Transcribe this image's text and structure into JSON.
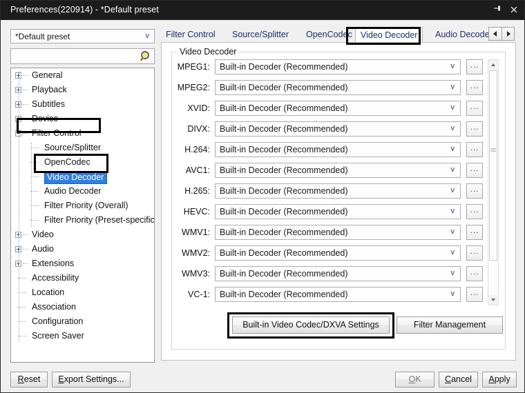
{
  "window": {
    "title": "Preferences(220914) - *Default preset",
    "pin_icon": "pin-icon",
    "close_icon": "close-icon"
  },
  "sidebar": {
    "preset": {
      "value": "*Default preset",
      "chevron": "v"
    },
    "search": {
      "value": "",
      "placeholder": "",
      "icon": "search-icon"
    },
    "tree": [
      {
        "label": "General",
        "level": 0,
        "expander": "plus"
      },
      {
        "label": "Playback",
        "level": 0,
        "expander": "plus"
      },
      {
        "label": "Subtitles",
        "level": 0,
        "expander": "plus"
      },
      {
        "label": "Device",
        "level": 0,
        "expander": "plus"
      },
      {
        "label": "Filter Control",
        "level": 0,
        "expander": "minus"
      },
      {
        "label": "Source/Splitter",
        "level": 1,
        "expander": "leaf"
      },
      {
        "label": "OpenCodec",
        "level": 1,
        "expander": "leaf"
      },
      {
        "label": "Video Decoder",
        "level": 1,
        "expander": "leaf",
        "selected": true
      },
      {
        "label": "Audio Decoder",
        "level": 1,
        "expander": "leaf"
      },
      {
        "label": "Filter Priority (Overall)",
        "level": 1,
        "expander": "leaf"
      },
      {
        "label": "Filter Priority (Preset-specific)",
        "level": 1,
        "expander": "leaf"
      },
      {
        "label": "Video",
        "level": 0,
        "expander": "plus"
      },
      {
        "label": "Audio",
        "level": 0,
        "expander": "plus"
      },
      {
        "label": "Extensions",
        "level": 0,
        "expander": "plus"
      },
      {
        "label": "Accessibility",
        "level": 0,
        "expander": "leaf"
      },
      {
        "label": "Location",
        "level": 0,
        "expander": "leaf"
      },
      {
        "label": "Association",
        "level": 0,
        "expander": "leaf"
      },
      {
        "label": "Configuration",
        "level": 0,
        "expander": "leaf"
      },
      {
        "label": "Screen Saver",
        "level": 0,
        "expander": "leaf"
      }
    ]
  },
  "tabs": {
    "items": [
      {
        "label": "Filter Control",
        "active": false
      },
      {
        "label": "Source/Splitter",
        "active": false
      },
      {
        "label": "OpenCodec",
        "active": false
      },
      {
        "label": "Video Decoder",
        "active": true
      },
      {
        "label": "Audio Decoder",
        "active": false
      }
    ],
    "scroll_left_icon": "triangle-left-icon",
    "scroll_right_icon": "triangle-right-icon"
  },
  "main": {
    "groupbox_title": "Video Decoder",
    "decoder_value": "Built-in Decoder (Recommended)",
    "combo_chevron": "v",
    "dots_label": "...",
    "rows": [
      {
        "codec": "MPEG1:",
        "value": "Built-in Decoder (Recommended)"
      },
      {
        "codec": "MPEG2:",
        "value": "Built-in Decoder (Recommended)"
      },
      {
        "codec": "XVID:",
        "value": "Built-in Decoder (Recommended)"
      },
      {
        "codec": "DIVX:",
        "value": "Built-in Decoder (Recommended)"
      },
      {
        "codec": "H.264:",
        "value": "Built-in Decoder (Recommended)"
      },
      {
        "codec": "AVC1:",
        "value": "Built-in Decoder (Recommended)"
      },
      {
        "codec": "H.265:",
        "value": "Built-in Decoder (Recommended)"
      },
      {
        "codec": "HEVC:",
        "value": "Built-in Decoder (Recommended)"
      },
      {
        "codec": "WMV1:",
        "value": "Built-in Decoder (Recommended)"
      },
      {
        "codec": "WMV2:",
        "value": "Built-in Decoder (Recommended)"
      },
      {
        "codec": "WMV3:",
        "value": "Built-in Decoder (Recommended)"
      },
      {
        "codec": "VC-1:",
        "value": "Built-in Decoder (Recommended)"
      },
      {
        "codec": "",
        "value": ""
      }
    ],
    "dxva_button": "Built-in Video Codec/DXVA Settings",
    "filter_management_button": "Filter Management"
  },
  "footer": {
    "reset": {
      "pre": "",
      "mnemonic": "R",
      "post": "eset"
    },
    "export": {
      "pre": "",
      "mnemonic": "E",
      "post": "xport Settings..."
    },
    "ok": {
      "pre": "",
      "mnemonic": "O",
      "post": "K"
    },
    "cancel": {
      "pre": "",
      "mnemonic": "C",
      "post": "ancel"
    },
    "apply": {
      "pre": "",
      "mnemonic": "A",
      "post": "pply"
    }
  },
  "colors": {
    "titlebar_bg": "#1c1c1c",
    "selection_blue": "#2f7fe0",
    "tab_text": "#1b2f6e",
    "annotation": "#000000",
    "window_bg": "#f0f0f0"
  }
}
